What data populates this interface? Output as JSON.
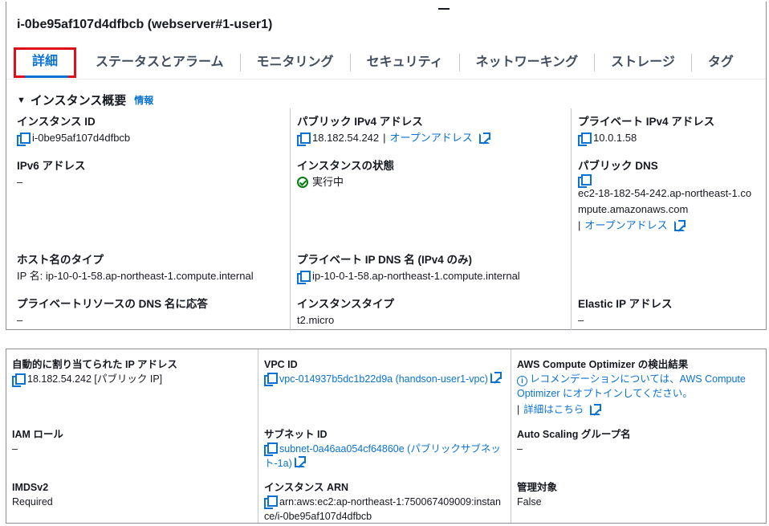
{
  "window": {
    "title": "i-0be95af107d4dfbcb (webserver#1-user1)"
  },
  "tabs": [
    {
      "label": "詳細"
    },
    {
      "label": "ステータスとアラーム"
    },
    {
      "label": "モニタリング"
    },
    {
      "label": "セキュリティ"
    },
    {
      "label": "ネットワーキング"
    },
    {
      "label": "ストレージ"
    },
    {
      "label": "タグ"
    }
  ],
  "summary": {
    "heading": "インスタンス概要",
    "info_link": "情報",
    "instance_id": {
      "label": "インスタンス ID",
      "value": "i-0be95af107d4dfbcb"
    },
    "public_ipv4": {
      "label": "パブリック IPv4 アドレス",
      "value": "18.182.54.242",
      "sep": "|",
      "link": "オープンアドレス"
    },
    "private_ipv4": {
      "label": "プライベート IPv4 アドレス",
      "value": "10.0.1.58"
    },
    "ipv6": {
      "label": "IPv6 アドレス",
      "value": "–"
    },
    "instance_state": {
      "label": "インスタンスの状態",
      "value": "実行中"
    },
    "public_dns": {
      "label": "パブリック DNS",
      "value": "ec2-18-182-54-242.ap-northeast-1.compute.amazonaws.com",
      "sep": "|",
      "link": "オープンアドレス"
    },
    "hostname_type": {
      "label": "ホスト名のタイプ",
      "value": "IP 名: ip-10-0-1-58.ap-northeast-1.compute.internal"
    },
    "private_ip_dns": {
      "label": "プライベート IP DNS 名 (IPv4 のみ)",
      "value": "ip-10-0-1-58.ap-northeast-1.compute.internal"
    },
    "private_resource_dns": {
      "label": "プライベートリソースの DNS 名に応答",
      "value": "–"
    },
    "instance_type": {
      "label": "インスタンスタイプ",
      "value": "t2.micro"
    },
    "elastic_ip": {
      "label": "Elastic IP アドレス",
      "value": "–"
    }
  },
  "details": {
    "auto_public_ip": {
      "label": "自動的に割り当てられた IP アドレス",
      "value": "18.182.54.242 [パブリック IP]"
    },
    "vpc_id": {
      "label": "VPC ID",
      "value": "vpc-014937b5dc1b22d9a (handson-user1-vpc)"
    },
    "compute_optimizer": {
      "label": "AWS Compute Optimizer の検出結果",
      "value": "レコメンデーションについては、AWS Compute Optimizer にオプトインしてください。",
      "sep": "|",
      "link": "詳細はこちら"
    },
    "iam_role": {
      "label": "IAM ロール",
      "value": "–"
    },
    "subnet_id": {
      "label": "サブネット ID",
      "value": "subnet-0a46aa054cf64860e (パブリックサブネット-1a)"
    },
    "auto_scaling": {
      "label": "Auto Scaling グループ名",
      "value": "–"
    },
    "imdsv2": {
      "label": "IMDSv2",
      "value": "Required"
    },
    "instance_arn": {
      "label": "インスタンス ARN",
      "value": "arn:aws:ec2:ap-northeast-1:750067409009:instance/i-0be95af107d4dfbcb"
    },
    "managed": {
      "label": "管理対象",
      "value": "False"
    }
  },
  "colors": {
    "link": "#0972d3",
    "success": "#037f0c",
    "highlight_border": "#e0101a"
  }
}
